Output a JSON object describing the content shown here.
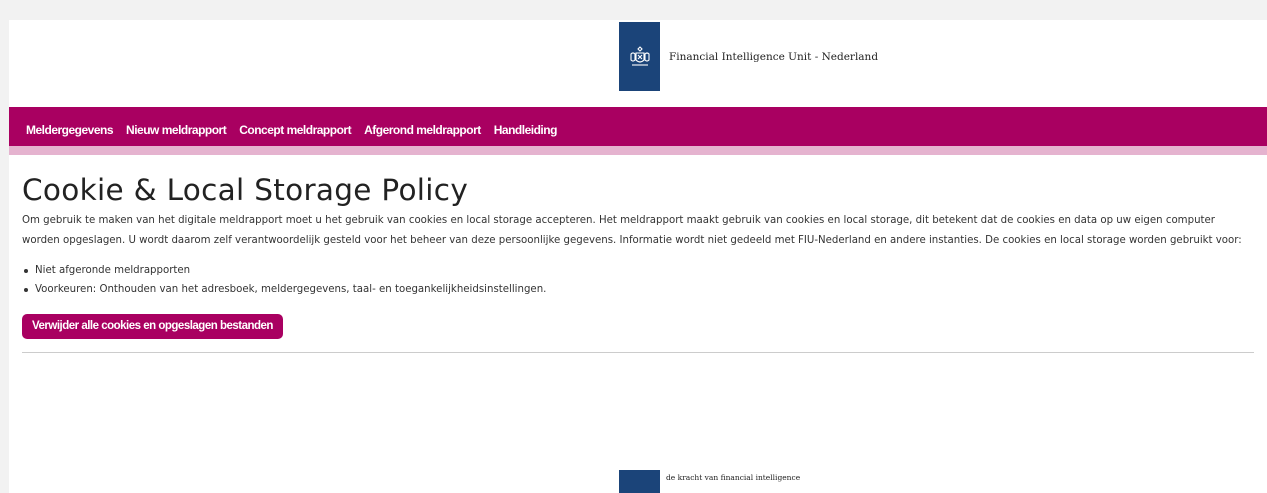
{
  "header": {
    "org_name": "Financial Intelligence Unit - Nederland",
    "logo_icon": "coat-of-arms-icon",
    "brand_color": "#1b4479"
  },
  "nav": {
    "accent_color": "#a90061",
    "items": [
      {
        "label": "Meldergegevens"
      },
      {
        "label": "Nieuw meldrapport"
      },
      {
        "label": "Concept meldrapport"
      },
      {
        "label": "Afgerond meldrapport"
      },
      {
        "label": "Handleiding"
      }
    ]
  },
  "main": {
    "title": "Cookie & Local Storage Policy",
    "intro": "Om gebruik te maken van het digitale meldrapport moet u het gebruik van cookies en local storage accepteren. Het meldrapport maakt gebruik van cookies en local storage, dit betekent dat de cookies en data op uw eigen computer worden opgeslagen. U wordt daarom zelf verantwoordelijk gesteld voor het beheer van deze persoonlijke gegevens. Informatie wordt niet gedeeld met FIU-Nederland en andere instanties. De cookies en local storage worden gebruikt voor:",
    "list": [
      "Niet afgeronde meldrapporten",
      "Voorkeuren: Onthouden van het adresboek, meldergegevens, taal- en toegankelijkheidsinstellingen."
    ],
    "delete_button": "Verwijder alle cookies en opgeslagen bestanden"
  },
  "footer": {
    "tagline": "de kracht van financial intelligence"
  }
}
